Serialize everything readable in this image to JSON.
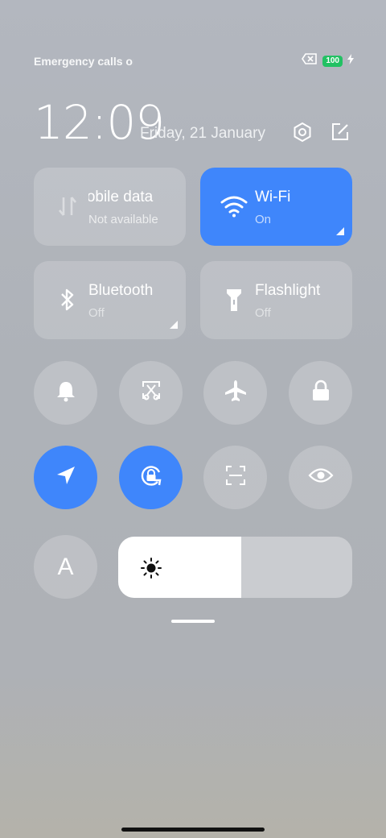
{
  "status_bar": {
    "carrier_text": "Emergency calls only",
    "battery_level": "100",
    "icons": [
      "no-sim-icon",
      "battery-icon",
      "charging-bolt-icon"
    ]
  },
  "header": {
    "time": "12:09",
    "date": "Friday, 21 January",
    "icons": [
      "settings-icon",
      "edit-icon"
    ]
  },
  "tiles": [
    {
      "label": "Mobile data",
      "status": "Not available",
      "icon": "mobile-data-icon",
      "active": false
    },
    {
      "label": "Wi-Fi",
      "status": "On",
      "icon": "wifi-icon",
      "active": true
    },
    {
      "label": "Bluetooth",
      "status": "Off",
      "icon": "bluetooth-icon",
      "active": false
    },
    {
      "label": "Flashlight",
      "status": "Off",
      "icon": "flashlight-icon",
      "active": false
    }
  ],
  "toggles_row1": [
    {
      "icon": "bell-icon",
      "active": false
    },
    {
      "icon": "screenshot-icon",
      "active": false
    },
    {
      "icon": "airplane-icon",
      "active": false
    },
    {
      "icon": "lock-icon",
      "active": false
    }
  ],
  "toggles_row2": [
    {
      "icon": "location-icon",
      "active": true
    },
    {
      "icon": "rotation-lock-icon",
      "active": true
    },
    {
      "icon": "scanner-icon",
      "active": false
    },
    {
      "icon": "eye-icon",
      "active": false
    }
  ],
  "auto_brightness_label": "A",
  "brightness": {
    "level": 0.525,
    "icon": "sun-icon"
  },
  "colors": {
    "accent": "#3f86fb",
    "battery": "#22c163"
  }
}
